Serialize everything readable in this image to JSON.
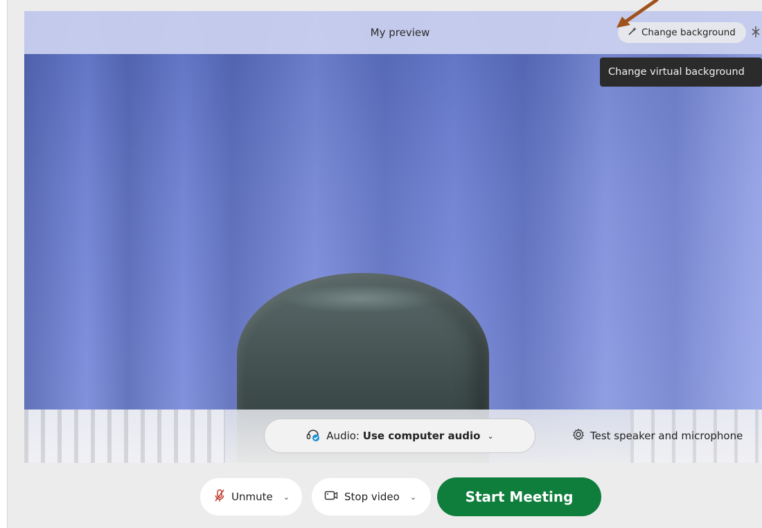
{
  "preview": {
    "title": "My preview",
    "change_background_label": "Change background",
    "tooltip": "Change virtual background",
    "wand_icon": "magic-wand-icon",
    "extra_icon": "more-settings-icon"
  },
  "audio": {
    "prefix": "Audio:",
    "value": "Use computer audio",
    "test_label": "Test speaker and microphone"
  },
  "controls": {
    "unmute_label": "Unmute",
    "stop_video_label": "Stop video",
    "start_label": "Start Meeting"
  },
  "colors": {
    "start_button": "#0f7d3b",
    "annotation_arrow": "#a0521c",
    "tooltip_bg": "#2b2b2b"
  }
}
